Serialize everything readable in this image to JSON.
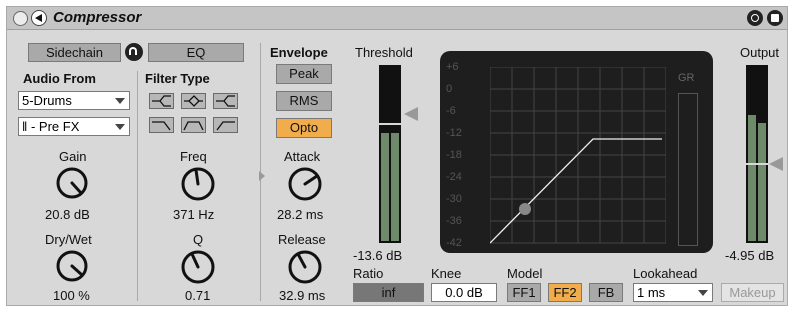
{
  "title": "Compressor",
  "sidechain_label": "Sidechain",
  "eq_label": "EQ",
  "audio_from": {
    "label": "Audio From",
    "source": "5-Drums",
    "tap": "ǁ - Pre FX"
  },
  "gain": {
    "label": "Gain",
    "value": "20.8 dB"
  },
  "drywet": {
    "label": "Dry/Wet",
    "value": "100 %"
  },
  "filter_type": {
    "label": "Filter Type"
  },
  "freq": {
    "label": "Freq",
    "value": "371 Hz"
  },
  "q": {
    "label": "Q",
    "value": "0.71"
  },
  "envelope": {
    "label": "Envelope",
    "peak": "Peak",
    "rms": "RMS",
    "opto": "Opto",
    "active": "Opto"
  },
  "attack": {
    "label": "Attack",
    "value": "28.2 ms"
  },
  "release": {
    "label": "Release",
    "value": "32.9 ms"
  },
  "threshold": {
    "label": "Threshold",
    "value": "-13.6 dB"
  },
  "graph": {
    "db_labels": [
      "+6",
      "0",
      "-6",
      "-12",
      "-18",
      "-24",
      "-30",
      "-36",
      "-42"
    ],
    "gr_label": "GR"
  },
  "output": {
    "label": "Output",
    "value": "-4.95 dB"
  },
  "ratio": {
    "label": "Ratio",
    "value": "inf"
  },
  "knee": {
    "label": "Knee",
    "value": "0.0 dB"
  },
  "model": {
    "label": "Model",
    "options": [
      "FF1",
      "FF2",
      "FB"
    ],
    "active": "FF2"
  },
  "lookahead": {
    "label": "Lookahead",
    "value": "1 ms"
  },
  "makeup_label": "Makeup",
  "colors": {
    "accent": "#f1ad4c",
    "panel": "#d8d8d8",
    "display": "#1e1e1e",
    "meter_green": "#6e8a6a"
  }
}
